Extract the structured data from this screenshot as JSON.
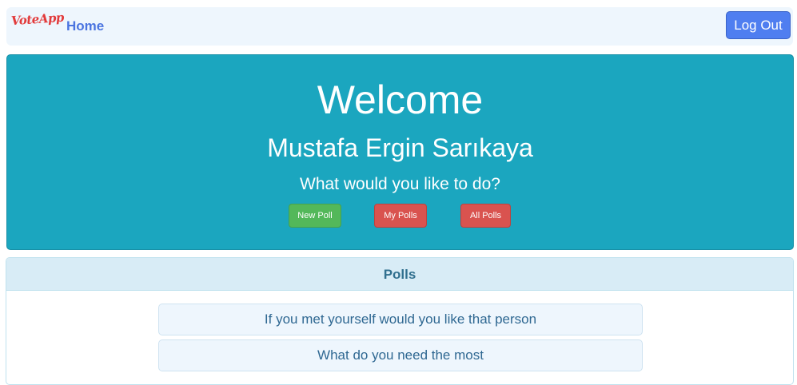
{
  "navbar": {
    "brand": "VoteApp",
    "home_label": "Home",
    "logout_label": "Log Out"
  },
  "hero": {
    "title": "Welcome",
    "user_name": "Mustafa Ergin Sarıkaya",
    "question": "What would you like to do?",
    "buttons": {
      "new_poll": "New Poll",
      "my_polls": "My Polls",
      "all_polls": "All Polls"
    }
  },
  "polls": {
    "header": "Polls",
    "items": [
      "If you met yourself would you like that person",
      "What do you need the most"
    ]
  },
  "colors": {
    "hero_background": "#1ba6bf",
    "primary_button": "#4f7ef0",
    "success_button": "#53b85a",
    "danger_button": "#d9534f",
    "brand": "#e23b3b"
  }
}
